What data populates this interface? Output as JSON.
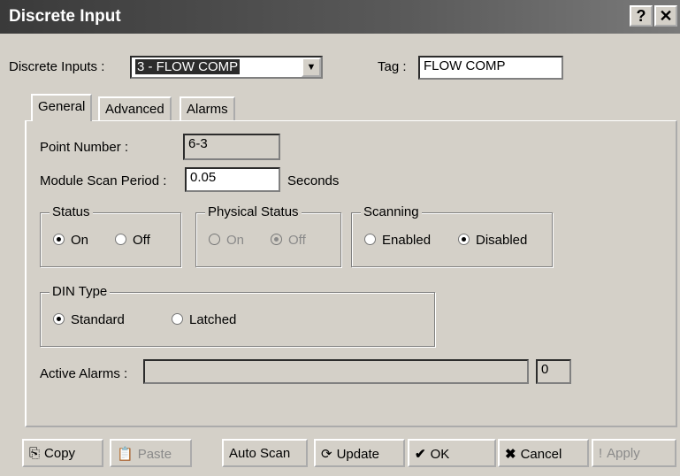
{
  "window": {
    "title": "Discrete Input",
    "help_glyph": "?",
    "close_glyph": "✕"
  },
  "selector": {
    "label": "Discrete Inputs :",
    "value": "3 - FLOW COMP",
    "tag_label": "Tag :",
    "tag_value": "FLOW COMP"
  },
  "tabs": [
    {
      "label": "General"
    },
    {
      "label": "Advanced"
    },
    {
      "label": "Alarms"
    }
  ],
  "general": {
    "point_number_label": "Point Number :",
    "point_number": "6-3",
    "scan_period_label": "Module Scan Period :",
    "scan_period": "0.05",
    "scan_unit": "Seconds",
    "status": {
      "title": "Status",
      "on": "On",
      "off": "Off",
      "selected": "On"
    },
    "physical_status": {
      "title": "Physical Status",
      "on": "On",
      "off": "Off",
      "selected": "Off"
    },
    "scanning": {
      "title": "Scanning",
      "enabled": "Enabled",
      "disabled": "Disabled",
      "selected": "Disabled"
    },
    "din_type": {
      "title": "DIN Type",
      "standard": "Standard",
      "latched": "Latched",
      "selected": "Standard"
    },
    "active_alarms_label": "Active Alarms :",
    "active_alarms_text": "",
    "active_alarms_count": "0"
  },
  "buttons": {
    "copy": "Copy",
    "paste": "Paste",
    "auto_scan": "Auto Scan",
    "update": "Update",
    "ok": "OK",
    "cancel": "Cancel",
    "apply": "Apply"
  }
}
